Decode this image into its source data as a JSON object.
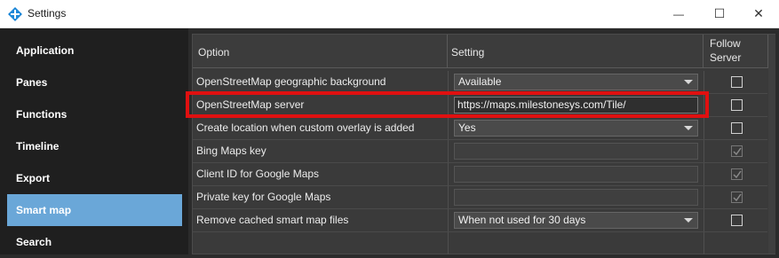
{
  "window": {
    "title": "Settings",
    "minimize_glyph": "—",
    "maximize_glyph": "☐",
    "close_glyph": "✕"
  },
  "sidebar": {
    "items": [
      {
        "label": "Application",
        "active": false
      },
      {
        "label": "Panes",
        "active": false
      },
      {
        "label": "Functions",
        "active": false
      },
      {
        "label": "Timeline",
        "active": false
      },
      {
        "label": "Export",
        "active": false
      },
      {
        "label": "Smart map",
        "active": true
      },
      {
        "label": "Search",
        "active": false
      }
    ]
  },
  "table": {
    "headers": {
      "option": "Option",
      "setting": "Setting",
      "follow_line1": "Follow",
      "follow_line2": "Server"
    },
    "rows": [
      {
        "option": "OpenStreetMap geographic background",
        "kind": "select",
        "value": "Available",
        "follow_checked": false,
        "follow_disabled": false
      },
      {
        "option": "OpenStreetMap server",
        "kind": "text",
        "value": "https://maps.milestonesys.com/Tile/",
        "follow_checked": false,
        "follow_disabled": false
      },
      {
        "option": "Create location when custom overlay is added",
        "kind": "select",
        "value": "Yes",
        "follow_checked": false,
        "follow_disabled": false
      },
      {
        "option": "Bing Maps key",
        "kind": "text",
        "value": "",
        "follow_checked": true,
        "follow_disabled": true
      },
      {
        "option": "Client ID for Google Maps",
        "kind": "text",
        "value": "",
        "follow_checked": true,
        "follow_disabled": true
      },
      {
        "option": "Private key for Google Maps",
        "kind": "text",
        "value": "",
        "follow_checked": true,
        "follow_disabled": true
      },
      {
        "option": "Remove cached smart map files",
        "kind": "select",
        "value": "When not used for 30 days",
        "follow_checked": false,
        "follow_disabled": false
      }
    ]
  },
  "colors": {
    "accent": "#6aa7d8",
    "highlight": "#e01010",
    "app_icon": "#1e88d8"
  }
}
